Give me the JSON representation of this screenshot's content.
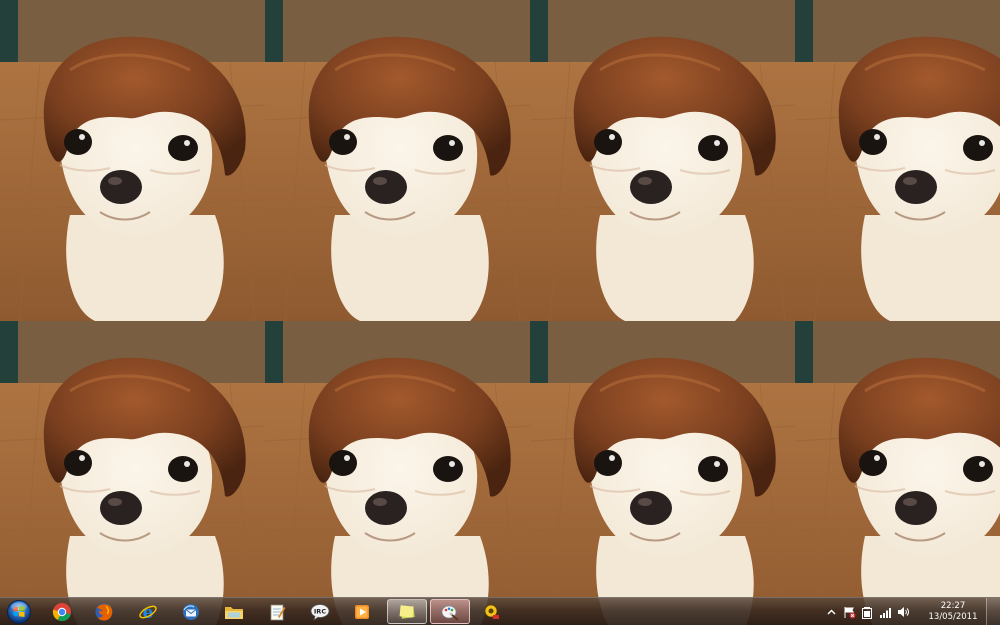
{
  "desktop": {
    "wallpaper": {
      "subject": "chihuahua-in-wig",
      "colors": {
        "floor": "#b57a46",
        "floor_dark": "#8f5a30",
        "wall": "#7a5e42",
        "fur": "#f3e8d6",
        "wig": "#7a3f1f",
        "eye": "#1a1410",
        "nose": "#2a2220"
      }
    }
  },
  "taskbar": {
    "start_button": {
      "icon": "windows-orb-icon"
    },
    "pinned": [
      {
        "name": "chrome",
        "icon": "chrome-icon"
      },
      {
        "name": "firefox",
        "icon": "firefox-icon"
      },
      {
        "name": "internet-explorer",
        "icon": "ie-icon"
      },
      {
        "name": "thunderbird",
        "icon": "thunderbird-icon"
      },
      {
        "name": "file-explorer",
        "icon": "folder-icon"
      },
      {
        "name": "notepad",
        "icon": "notepad-icon"
      },
      {
        "name": "irc-client",
        "icon": "irc-icon"
      },
      {
        "name": "media-player",
        "icon": "media-player-icon"
      },
      {
        "name": "sticky-notes",
        "icon": "sticky-notes-icon",
        "state": "active"
      },
      {
        "name": "paint",
        "icon": "paint-icon",
        "state": "pressed"
      },
      {
        "name": "utility",
        "icon": "utility-icon"
      }
    ],
    "tray": {
      "icons": [
        "show-hidden-chevron-icon",
        "flag-icon",
        "battery-icon",
        "network-icon",
        "volume-icon"
      ],
      "clock": {
        "time": "22:27",
        "date": "13/05/2011"
      }
    }
  }
}
